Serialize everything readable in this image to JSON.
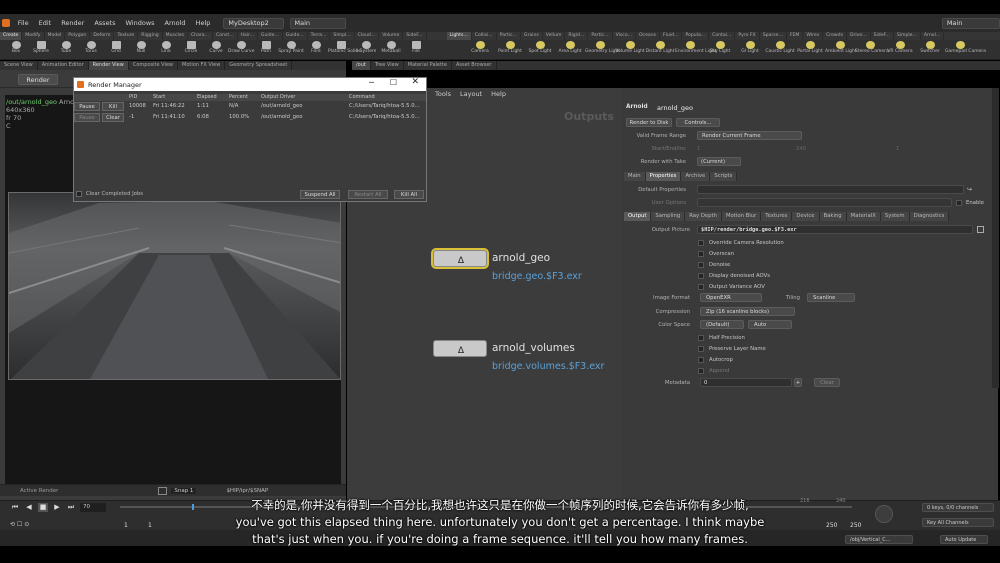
{
  "menubar": {
    "items": [
      "File",
      "Edit",
      "Render",
      "Assets",
      "Windows",
      "Arnold",
      "Help"
    ],
    "desktop": "MyDesktop2",
    "context": "Main",
    "right_context": "Main"
  },
  "shelf_tabs_left": [
    "Create",
    "Modify",
    "Model",
    "Polygon",
    "Deform",
    "Texture",
    "Rigging",
    "Muscles",
    "Chara...",
    "Const...",
    "Hair...",
    "Guide...",
    "Guide...",
    "Terra...",
    "Simpl...",
    "Cloud...",
    "Volume",
    "SideF..."
  ],
  "shelf_tabs_right": [
    "Lights...",
    "Collisi...",
    "Partic...",
    "Grains",
    "Vellum",
    "Rigid...",
    "Partic...",
    "Visco...",
    "Oceans",
    "Fluid...",
    "Popula...",
    "Contai...",
    "Pyro FX",
    "Sparse...",
    "FEM",
    "Wires",
    "Crowds",
    "Drive...",
    "SideF...",
    "Simple...",
    "Arnol..."
  ],
  "shelf_tools_left": [
    "Box",
    "Sphere",
    "Tube",
    "Torus",
    "Grid",
    "Null",
    "Line",
    "Circle",
    "Curve",
    "Draw Curve",
    "Path",
    "Spray Paint",
    "Font",
    "Platonic Solids",
    "L-System",
    "Metaball",
    "File"
  ],
  "shelf_tools_right": [
    "Camera",
    "Point Light",
    "Spot Light",
    "Area Light",
    "Geometry Light",
    "Volume Light",
    "Distant Light",
    "Environment Light",
    "Sky Light",
    "GI Light",
    "Caustic Light",
    "Portal Light",
    "Ambient Light",
    "Stereo Camera",
    "VR Camera",
    "Switcher",
    "Gamepad Camera"
  ],
  "pane_tabs_left": [
    "Scene View",
    "Animation Editor",
    "Render View",
    "Composite View",
    "Motion FX View",
    "Geometry Spreadsheet"
  ],
  "pane_tabs_right": [
    "/out",
    "Tree View",
    "Material Palette",
    "Asset Browser"
  ],
  "left_pane": {
    "render_button": "Render",
    "path_line": "/out/arnold_geo",
    "path_suffix": "Arnol",
    "res": "640x360",
    "fr": "fr 70",
    "c": "C",
    "active_render": "Active Render",
    "snap": "Snap 1",
    "ipr_path": "$HIP/ipr/$SNAP"
  },
  "render_manager": {
    "title": "Render Manager",
    "columns": [
      "PID",
      "Start",
      "Elapsed",
      "Percent",
      "Output Driver",
      "Command"
    ],
    "rows": [
      {
        "btn1": "Pause",
        "btn2": "Kill",
        "pid": "10008",
        "start": "Fri 11:46:22",
        "elapsed": "1:11",
        "percent": "N/A",
        "driver": "/out/arnold_geo",
        "command": "C:/Users/Tariq/htoa-5.5.0..."
      },
      {
        "btn1": "Pause",
        "btn2": "Clear",
        "pid": "-1",
        "start": "Fri 11:41:10",
        "elapsed": "6:08",
        "percent": "100.0%",
        "driver": "/out/arnold_geo",
        "command": "C:/Users/Tariq/htoa-5.5.0..."
      }
    ],
    "clear_completed": "Clear Completed Jobs",
    "suspend_all": "Suspend All",
    "restart_all": "Restart All",
    "kill_all": "Kill All"
  },
  "network": {
    "menu": [
      "Tools",
      "Layout",
      "Help"
    ],
    "context_label": "Outputs",
    "nodes": [
      {
        "name": "arnold_geo",
        "output": "bridge.geo.$F3.exr"
      },
      {
        "name": "arnold_volumes",
        "output": "bridge.volumes.$F3.exr"
      }
    ]
  },
  "params": {
    "node_type": "Arnold",
    "node_name": "arnold_geo",
    "render_to_disk": "Render to Disk",
    "controls": "Controls...",
    "valid_frame_range_label": "Valid Frame Range",
    "valid_frame_range": "Render Current Frame",
    "start_end_label": "Start/End/Inc",
    "start": "1",
    "end": "240",
    "inc": "1",
    "render_with_take_label": "Render with Take",
    "take": "(Current)",
    "top_tabs": [
      "Main",
      "Properties",
      "Archive",
      "Scripts"
    ],
    "default_properties": "Default Properties",
    "user_options": "User Options",
    "enable": "Enable",
    "sub_tabs": [
      "Output",
      "Sampling",
      "Ray Depth",
      "Motion Blur",
      "Textures",
      "Device",
      "Baking",
      "MaterialX",
      "System",
      "Diagnostics"
    ],
    "output_picture_label": "Output Picture",
    "output_picture": "$HIP/render/bridge.geo.$F3.exr",
    "checkboxes": [
      "Override Camera Resolution",
      "Overscan",
      "Denoise",
      "Display denoised AOVs",
      "Output Variance AOV"
    ],
    "image_format_label": "Image Format",
    "image_format": "OpenEXR",
    "tiling_label": "Tiling",
    "tiling": "Scanline",
    "compression_label": "Compression",
    "compression": "Zip (16 scanline blocks)",
    "color_space_label": "Color Space",
    "color_space": "(Default)",
    "color_space2": "Auto",
    "checkboxes2": [
      "Half Precision",
      "Preserve Layer Name",
      "Autocrop",
      "Append"
    ],
    "metadata_label": "Metadata",
    "metadata": "0",
    "clear": "Clear"
  },
  "timeline": {
    "frame": "70",
    "start": "1",
    "start2": "1",
    "end": "250",
    "end2": "250",
    "ticks": [
      "216",
      "240"
    ],
    "keys": "0 keys, 0/0 channels",
    "key_all": "Key All Channels",
    "obj_path": "/obj/Vertical_C...",
    "auto_update": "Auto Update"
  },
  "subtitles": {
    "zh": "不幸的是,你并没有得到一个百分比,我想也许这只是在你做一个帧序列的时候,它会告诉你有多少帧,",
    "en1": "you've got this elapsed thing here. unfortunately you don't get a percentage. I think maybe",
    "en2": "that's just when you. if you're doing a frame sequence. it'll tell you how many frames."
  },
  "colors": {
    "accent_yellow": "#d9c038",
    "link_blue": "#5aa0d8",
    "path_green": "#6fd06f"
  }
}
